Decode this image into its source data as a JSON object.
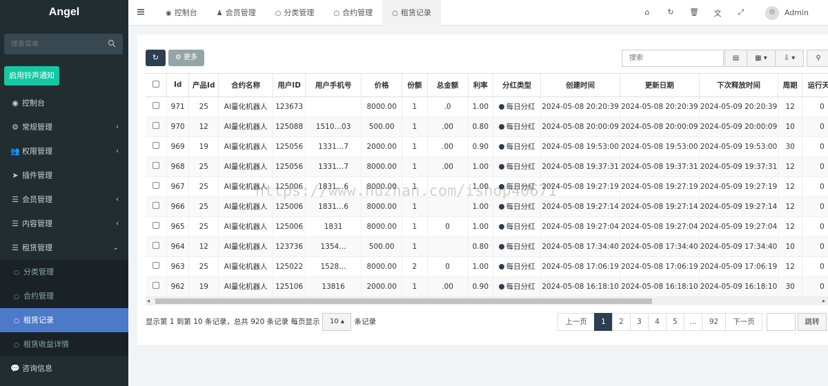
{
  "brand": "Angel",
  "sidebar": {
    "search_placeholder": "搜索菜单",
    "bell_button": "启用铃声通知",
    "items": [
      {
        "label": "控制台",
        "icon": "dashboard-icon",
        "glyph": "◉",
        "arrow": ""
      },
      {
        "label": "常规管理",
        "icon": "cogs-icon",
        "glyph": "⚙",
        "arrow": "‹"
      },
      {
        "label": "权限管理",
        "icon": "users-icon",
        "glyph": "👥",
        "arrow": "‹"
      },
      {
        "label": "插件管理",
        "icon": "rocket-icon",
        "glyph": "➤",
        "arrow": ""
      },
      {
        "label": "会员管理",
        "icon": "list-icon",
        "glyph": "☰",
        "arrow": "‹"
      },
      {
        "label": "内容管理",
        "icon": "list-icon",
        "glyph": "☰",
        "arrow": "‹"
      },
      {
        "label": "租赁管理",
        "icon": "list-icon",
        "glyph": "☰",
        "arrow": "⌄"
      },
      {
        "label": "分类管理",
        "icon": "circle-icon",
        "glyph": "○",
        "sub": true
      },
      {
        "label": "合约管理",
        "icon": "circle-icon",
        "glyph": "○",
        "sub": true
      },
      {
        "label": "租赁记录",
        "icon": "circle-icon",
        "glyph": "○",
        "sub": true,
        "active": true
      },
      {
        "label": "租赁收益详情",
        "icon": "circle-icon",
        "glyph": "○",
        "sub": true
      },
      {
        "label": "咨询信息",
        "icon": "comments-icon",
        "glyph": "💬",
        "arrow": ""
      }
    ]
  },
  "topbar": {
    "tabs": [
      {
        "label": "控制台",
        "icon": "dashboard-icon",
        "glyph": "◉"
      },
      {
        "label": "会员管理",
        "icon": "user-icon",
        "glyph": "♟"
      },
      {
        "label": "分类管理",
        "icon": "circle-icon",
        "glyph": "○"
      },
      {
        "label": "合约管理",
        "icon": "circle-icon",
        "glyph": "○"
      },
      {
        "label": "租赁记录",
        "icon": "circle-icon",
        "glyph": "○",
        "active": true
      }
    ],
    "tools": [
      {
        "icon": "home-icon",
        "glyph": "⌂"
      },
      {
        "icon": "refresh-icon",
        "glyph": "↻"
      },
      {
        "icon": "trash-icon",
        "glyph": "🗑"
      },
      {
        "icon": "translate-icon",
        "glyph": "文"
      },
      {
        "icon": "fullscreen-icon",
        "glyph": "⤢"
      }
    ],
    "user": "Admin"
  },
  "toolbar": {
    "more_label": "更多",
    "search_placeholder": "搜索"
  },
  "table": {
    "columns": [
      "Id",
      "产品Id",
      "合约名称",
      "用户ID",
      "用户手机号",
      "价格",
      "份额",
      "总金额",
      "利率",
      "分红类型",
      "创建时间",
      "更新日期",
      "下次释放时间",
      "周期",
      "运行天数"
    ],
    "rows": [
      [
        "971",
        "25",
        "AI量化机器人",
        "123673",
        "",
        "8000.00",
        "1",
        ".0",
        "1.00",
        "每日分红",
        "2024-05-08 20:20:39",
        "2024-05-08 20:20:39",
        "2024-05-09 20:20:39",
        "12",
        "0"
      ],
      [
        "970",
        "12",
        "AI量化机器人",
        "125088",
        "1510…03",
        "500.00",
        "1",
        ".00",
        "0.80",
        "每日分红",
        "2024-05-08 20:00:09",
        "2024-05-08 20:00:09",
        "2024-05-09 20:00:09",
        "10",
        "0"
      ],
      [
        "969",
        "19",
        "AI量化机器人",
        "125056",
        "1331…7",
        "2000.00",
        "1",
        ".00",
        "0.90",
        "每日分红",
        "2024-05-08 19:53:00",
        "2024-05-08 19:53:00",
        "2024-05-09 19:53:00",
        "30",
        "0"
      ],
      [
        "968",
        "25",
        "AI量化机器人",
        "125056",
        "1331…7",
        "8000.00",
        "1",
        ".00",
        "1.00",
        "每日分红",
        "2024-05-08 19:37:31",
        "2024-05-08 19:37:31",
        "2024-05-09 19:37:31",
        "12",
        "0"
      ],
      [
        "967",
        "25",
        "AI量化机器人",
        "125006",
        "1831…6",
        "8000.00",
        "1",
        "",
        "1.00",
        "每日分红",
        "2024-05-08 19:27:19",
        "2024-05-08 19:27:19",
        "2024-05-09 19:27:19",
        "12",
        "0"
      ],
      [
        "966",
        "25",
        "AI量化机器人",
        "125006",
        "1831…6",
        "8000.00",
        "1",
        "",
        "1.00",
        "每日分红",
        "2024-05-08 19:27:14",
        "2024-05-08 19:27:14",
        "2024-05-09 19:27:14",
        "12",
        "0"
      ],
      [
        "965",
        "25",
        "AI量化机器人",
        "125006",
        "1831",
        "8000.00",
        "1",
        "0",
        "1.00",
        "每日分红",
        "2024-05-08 19:27:04",
        "2024-05-08 19:27:04",
        "2024-05-09 19:27:04",
        "12",
        "0"
      ],
      [
        "964",
        "12",
        "AI量化机器人",
        "123736",
        "1354…",
        "500.00",
        "1",
        "",
        "0.80",
        "每日分红",
        "2024-05-08 17:34:40",
        "2024-05-08 17:34:40",
        "2024-05-09 17:34:40",
        "10",
        "0"
      ],
      [
        "963",
        "25",
        "AI量化机器人",
        "125022",
        "1528…",
        "8000.00",
        "2",
        "0",
        "1.00",
        "每日分红",
        "2024-05-08 17:06:19",
        "2024-05-08 17:06:19",
        "2024-05-09 17:06:19",
        "12",
        "0"
      ],
      [
        "962",
        "19",
        "AI量化机器人",
        "125106",
        "13816",
        "2000.00",
        "1",
        ".00",
        "0.90",
        "每日分红",
        "2024-05-08 16:18:10",
        "2024-05-08 16:18:10",
        "2024-05-09 16:18:10",
        "30",
        "0"
      ]
    ]
  },
  "footer": {
    "info_text": "显示第 1 到第 10 条记录，总共 920 条记录 每页显示",
    "page_size": "10",
    "suffix": "条记录",
    "prev": "上一页",
    "next": "下一页",
    "pages": [
      "1",
      "2",
      "3",
      "4",
      "5",
      "...",
      "92"
    ],
    "goto": "跳转"
  },
  "watermark": "https://www.huzhan.com/ishop40671"
}
